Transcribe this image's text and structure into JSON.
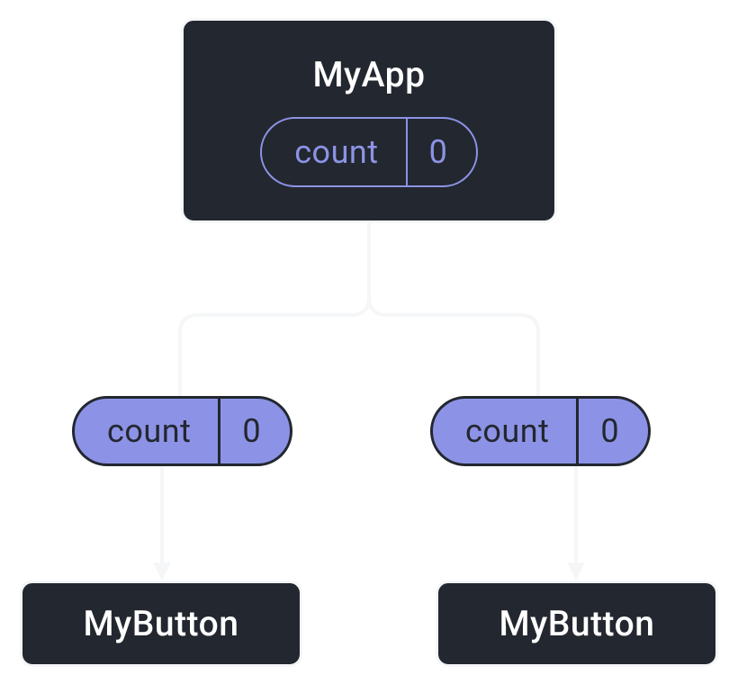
{
  "diagram": {
    "parent": {
      "title": "MyApp",
      "state": {
        "label": "count",
        "value": "0"
      }
    },
    "props": {
      "left": {
        "label": "count",
        "value": "0"
      },
      "right": {
        "label": "count",
        "value": "0"
      }
    },
    "children": {
      "left": {
        "title": "MyButton"
      },
      "right": {
        "title": "MyButton"
      }
    }
  }
}
